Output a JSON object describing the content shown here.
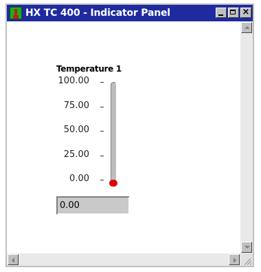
{
  "window": {
    "title": "HX TC 400 - Indicator Panel"
  },
  "indicator": {
    "label": "Temperature 1",
    "scale_ticks": [
      "100.00",
      "75.00",
      "50.00",
      "25.00",
      "0.00"
    ],
    "scale_min": 0,
    "scale_max": 100,
    "value": 0,
    "display_text": "0.00",
    "fill_color": "#e00000"
  },
  "colors": {
    "titlebar": "#1f2a9f",
    "app_icon": "#18b018"
  },
  "icons": [
    "app-icon",
    "minimize-icon",
    "maximize-icon",
    "close-icon",
    "scroll-up-icon",
    "scroll-down-icon",
    "scroll-left-icon",
    "scroll-right-icon",
    "size-grip-icon"
  ]
}
